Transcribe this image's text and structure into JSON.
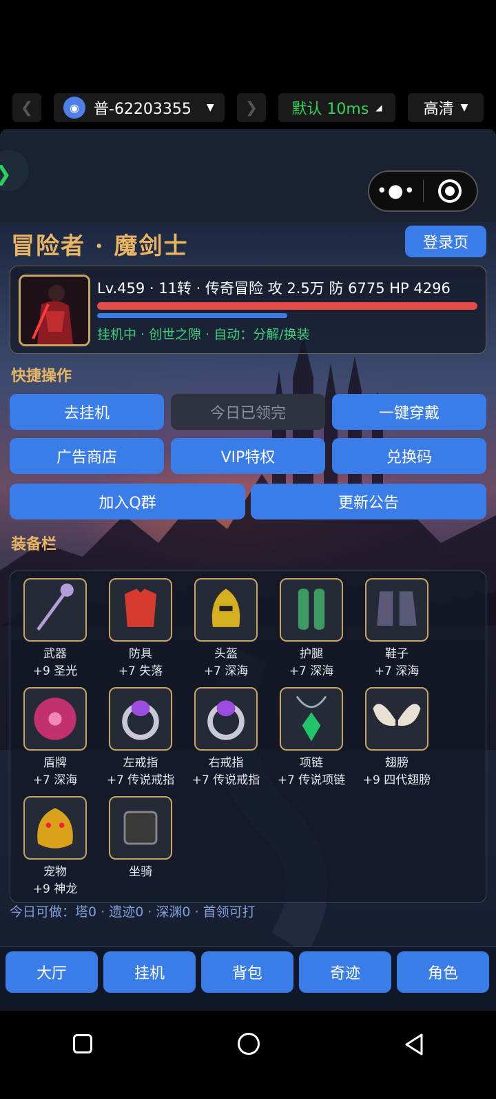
{
  "topbar": {
    "device_label": "普-62203355",
    "mode_label": "默认 10ms",
    "quality_label": "高清"
  },
  "game": {
    "title": "冒险者 · 魔剑士",
    "login_button": "登录页",
    "character": {
      "stats": "Lv.459 · 11转 · 传奇冒险  攻 2.5万   防 6775   HP 4296",
      "status": "挂机中 · 创世之隙 · 自动：分解/换装",
      "hp_fraction": 1.0,
      "exp_fraction": 0.5
    },
    "quick_label": "快捷操作",
    "quick": {
      "idle": "去挂机",
      "claimed": "今日已领完",
      "equip_all": "一键穿戴",
      "ad_shop": "广告商店",
      "vip": "VIP特权",
      "redeem": "兑换码",
      "join_group": "加入Q群",
      "notice": "更新公告"
    },
    "equip_label": "装备栏",
    "equipment": [
      {
        "name": "武器",
        "enh": "+9 圣光",
        "icon": "staff-icon",
        "color": "#b39ddb"
      },
      {
        "name": "防具",
        "enh": "+7 失落",
        "icon": "armor-icon",
        "color": "#d63a2f"
      },
      {
        "name": "头盔",
        "enh": "+7 深海",
        "icon": "helmet-icon",
        "color": "#d4b020"
      },
      {
        "name": "护腿",
        "enh": "+7 深海",
        "icon": "leggings-icon",
        "color": "#3e9a63"
      },
      {
        "name": "鞋子",
        "enh": "+7 深海",
        "icon": "boots-icon",
        "color": "#5a5a78"
      },
      {
        "name": "盾牌",
        "enh": "+7 深海",
        "icon": "shield-icon",
        "color": "#c2306e"
      },
      {
        "name": "左戒指",
        "enh": "+7 传说戒指",
        "icon": "ring-icon",
        "color": "#9c4de0"
      },
      {
        "name": "右戒指",
        "enh": "+7 传说戒指",
        "icon": "ring-icon",
        "color": "#9c4de0"
      },
      {
        "name": "项链",
        "enh": "+7 传说项链",
        "icon": "necklace-icon",
        "color": "#22c46a"
      },
      {
        "name": "翅膀",
        "enh": "+9 四代翅膀",
        "icon": "wings-icon",
        "color": "#e8e0d0"
      },
      {
        "name": "宠物",
        "enh": "+9 神龙",
        "icon": "dragon-icon",
        "color": "#d9a21a"
      },
      {
        "name": "坐骑",
        "enh": "",
        "icon": "empty-slot-icon",
        "color": "#555555"
      }
    ],
    "today": "今日可做：塔0 · 遗迹0 · 深渊0 · 首领可打",
    "tabs": [
      "大厅",
      "挂机",
      "背包",
      "奇迹",
      "角色"
    ]
  }
}
